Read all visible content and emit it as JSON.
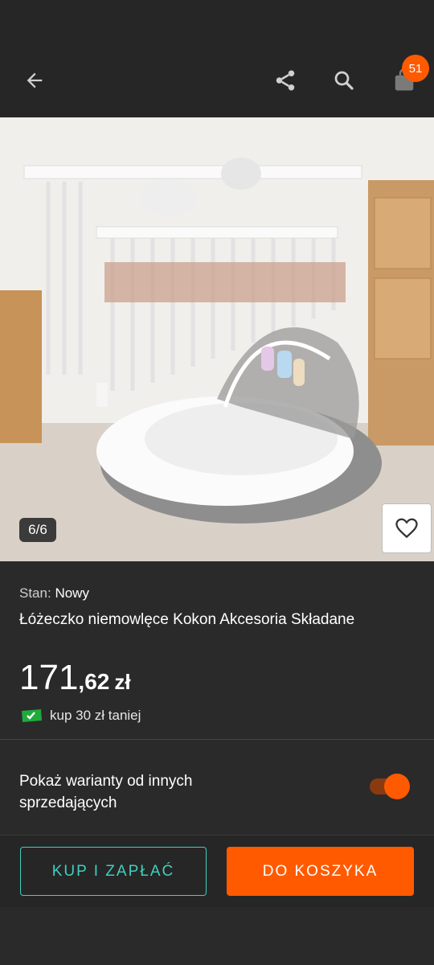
{
  "toolbar": {
    "back_icon": "arrow-left-icon",
    "share_icon": "share-icon",
    "search_icon": "search-icon",
    "cart_icon": "shopping-bag-icon",
    "cart_count": "51"
  },
  "gallery": {
    "counter": "6/6",
    "favorite_icon": "heart-icon"
  },
  "product": {
    "condition_label": "Stan:",
    "condition_value": "Nowy",
    "title": "Łóżeczko niemowlęce Kokon Akcesoria Składane",
    "price_int": "171",
    "price_dec": ",62",
    "price_currency": "zł",
    "promo_text": "kup 30 zł taniej"
  },
  "variants": {
    "label": "Pokaż warianty od innych sprzedających",
    "toggle_on": true
  },
  "actions": {
    "buy_label": "KUP I ZAPŁAĆ",
    "cart_label": "DO KOSZYKA"
  },
  "colors": {
    "accent": "#ff5a00",
    "teal": "#3fd0bf",
    "background": "#2a2a2a"
  }
}
